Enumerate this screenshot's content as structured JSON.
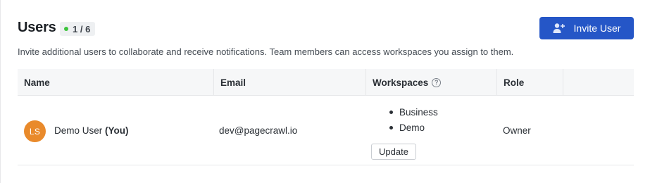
{
  "header": {
    "title": "Users",
    "count_badge": "1 / 6",
    "invite_button": "Invite User",
    "subtitle": "Invite additional users to collaborate and receive notifications. Team members can access workspaces you assign to them."
  },
  "table": {
    "columns": [
      "Name",
      "Email",
      "Workspaces",
      "Role"
    ],
    "rows": [
      {
        "avatar_initials": "LS",
        "name": "Demo User",
        "you_tag": "(You)",
        "email": "dev@pagecrawl.io",
        "workspaces": [
          "Business",
          "Demo"
        ],
        "update_button": "Update",
        "role": "Owner"
      }
    ]
  },
  "colors": {
    "primary_button": "#2556c7",
    "avatar": "#e98a2b",
    "status_dot": "#3cc43c"
  },
  "icons": {
    "invite": "add-user-icon",
    "workspaces_help": "help-circle-icon"
  }
}
